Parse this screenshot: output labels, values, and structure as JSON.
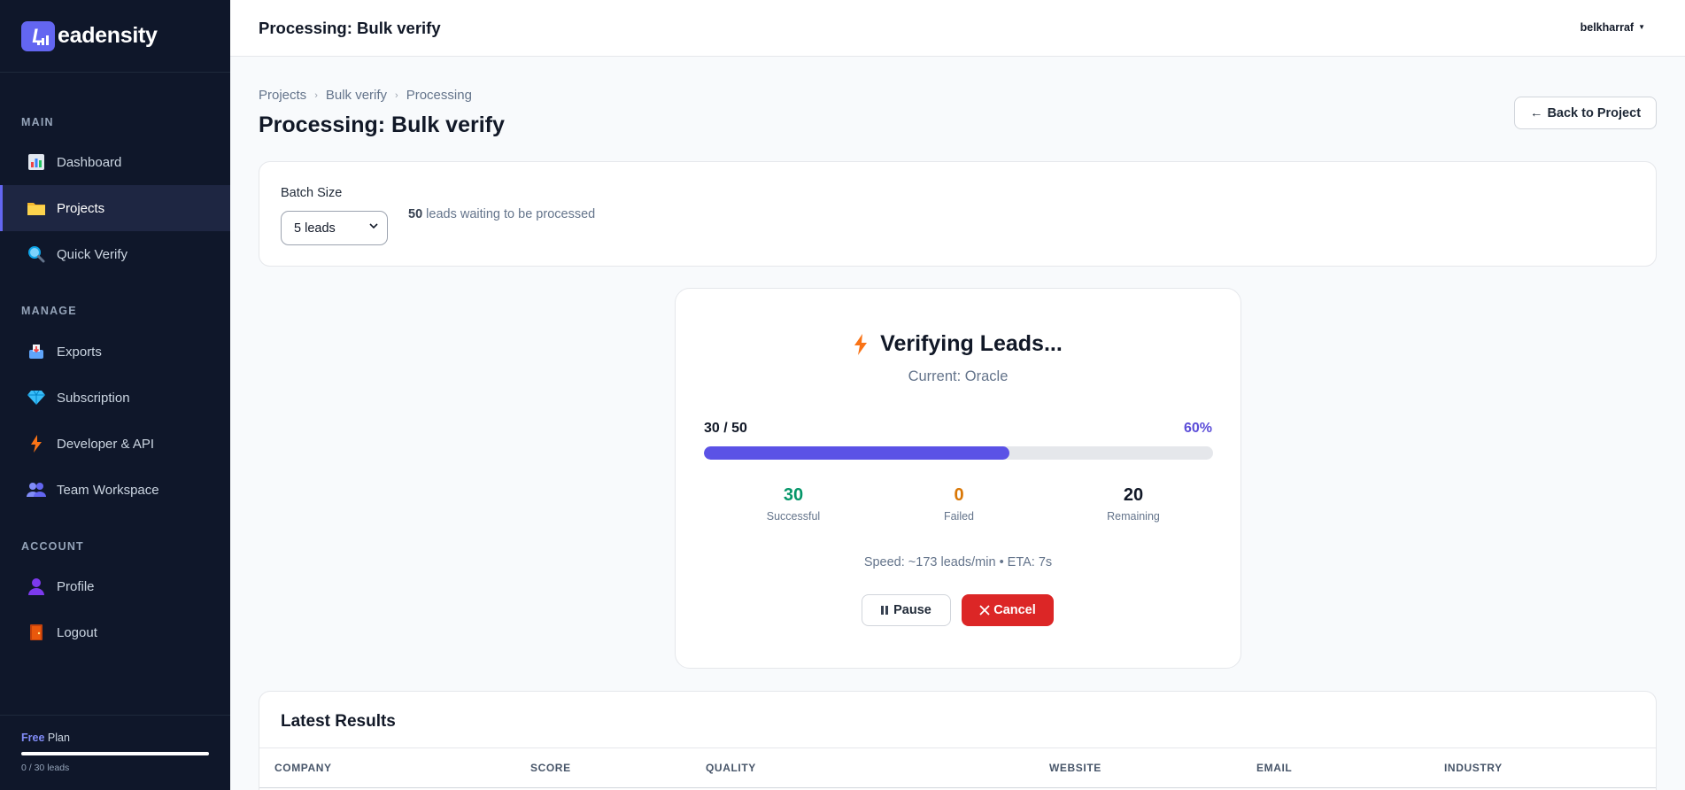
{
  "brand": {
    "name": "eadensity",
    "logo_letter": "L"
  },
  "sidebar": {
    "sections": {
      "main": "MAIN",
      "manage": "MANAGE",
      "account": "ACCOUNT"
    },
    "items": [
      {
        "label": "Dashboard",
        "icon": "bar-chart-icon"
      },
      {
        "label": "Projects",
        "icon": "folder-icon"
      },
      {
        "label": "Quick Verify",
        "icon": "magnifier-icon"
      },
      {
        "label": "Exports",
        "icon": "inbox-tray-icon"
      },
      {
        "label": "Subscription",
        "icon": "gem-icon"
      },
      {
        "label": "Developer & API",
        "icon": "lightning-icon"
      },
      {
        "label": "Team Workspace",
        "icon": "people-icon"
      },
      {
        "label": "Profile",
        "icon": "person-icon"
      },
      {
        "label": "Logout",
        "icon": "door-icon"
      }
    ],
    "plan": {
      "tier": "Free",
      "word": "Plan",
      "usage": "0 / 30 leads",
      "usage_fraction": 0
    }
  },
  "topbar": {
    "title": "Processing: Bulk verify",
    "user": "belkharraf"
  },
  "breadcrumb": [
    "Projects",
    "Bulk verify",
    "Processing"
  ],
  "page": {
    "title": "Processing: Bulk verify",
    "back_label": "Back to Project"
  },
  "batch": {
    "label": "Batch Size",
    "selected": "5 leads",
    "waiting_count": "50",
    "waiting_text": "leads waiting to be processed"
  },
  "progress": {
    "title": "Verifying Leads...",
    "current": "Current: Oracle",
    "count_text": "30 / 50",
    "percent_text": "60%",
    "fraction": 0.6,
    "stats": [
      {
        "value": "30",
        "label": "Successful",
        "color": "#059669"
      },
      {
        "value": "0",
        "label": "Failed",
        "color": "#d97706"
      },
      {
        "value": "20",
        "label": "Remaining",
        "color": "#111827"
      }
    ],
    "speed": "Speed: ~173 leads/min • ETA: 7s",
    "pause_label": "Pause",
    "cancel_label": "Cancel"
  },
  "results": {
    "title": "Latest Results",
    "columns": [
      "COMPANY",
      "SCORE",
      "QUALITY",
      "WEBSITE",
      "EMAIL",
      "INDUSTRY"
    ]
  },
  "colors": {
    "accent": "#6366f1",
    "sidebar_bg": "#0f172a",
    "danger": "#dc2626"
  }
}
